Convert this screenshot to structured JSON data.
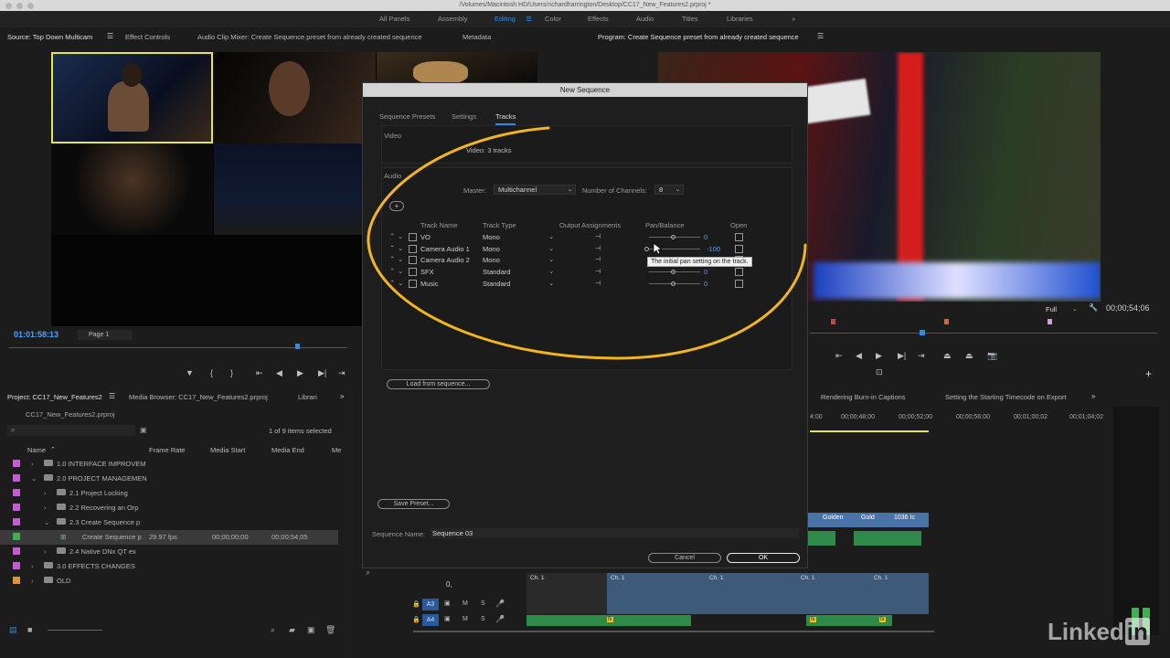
{
  "titlebar": {
    "path": "/Volumes/Macintosh HD/Users/richardharrington/Desktop/CC17_New_Features2.prproj *"
  },
  "workspaces": [
    "All Panels",
    "Assembly",
    "Editing",
    "Color",
    "Effects",
    "Audio",
    "Titles",
    "Libraries"
  ],
  "source_panel": {
    "tabs": [
      "Source: Top Down Multicam",
      "Effect Controls",
      "Audio Clip Mixer: Create Sequence preset from already created sequence",
      "Metadata"
    ],
    "timecode": "01:01:58:13",
    "page": "Page 1"
  },
  "program_panel": {
    "title": "Program: Create Sequence preset from already created sequence",
    "timecode": "00;00;54;06",
    "zoom": "Full"
  },
  "project_panel": {
    "tabs": [
      "Project: CC17_New_Features2",
      "Media Browser: CC17_New_Features2.prproj",
      "Librari"
    ],
    "file": "CC17_New_Features2.prproj",
    "selection": "1 of 9 items selected",
    "columns": [
      "Name",
      "Frame Rate",
      "Media Start",
      "Media End",
      "Me"
    ],
    "rows": [
      {
        "name": "1.0 INTERFACE IMPROVEM",
        "color": "#c85bd1",
        "indent": 0,
        "frame_rate": "",
        "start": "",
        "end": ""
      },
      {
        "name": "2.0 PROJECT MANAGEMEN",
        "color": "#c85bd1",
        "indent": 0,
        "frame_rate": "",
        "start": "",
        "end": ""
      },
      {
        "name": "2.1 Project Locking",
        "color": "#c85bd1",
        "indent": 1,
        "frame_rate": "",
        "start": "",
        "end": ""
      },
      {
        "name": "2.2 Recovering an Orp",
        "color": "#c85bd1",
        "indent": 1,
        "frame_rate": "",
        "start": "",
        "end": ""
      },
      {
        "name": "2.3 Create Sequence p",
        "color": "#c85bd1",
        "indent": 1,
        "frame_rate": "",
        "start": "",
        "end": ""
      },
      {
        "name": "Create Sequence p",
        "color": "#3fae54",
        "indent": 2,
        "frame_rate": "29.97 fps",
        "start": "00;00;00;00",
        "end": "00;00;54;05"
      },
      {
        "name": "2.4 Native DNx QT ex",
        "color": "#c85bd1",
        "indent": 1,
        "frame_rate": "",
        "start": "",
        "end": ""
      },
      {
        "name": "3.0 EFFECTS CHANGES",
        "color": "#c85bd1",
        "indent": 0,
        "frame_rate": "",
        "start": "",
        "end": ""
      },
      {
        "name": "OLD",
        "color": "#e0923a",
        "indent": 0,
        "frame_rate": "",
        "start": "",
        "end": ""
      }
    ]
  },
  "timeline": {
    "tabs": [
      "Rendering Burn-in Captions",
      "Setting the Starting Timecode on Export"
    ],
    "ruler": [
      "4:00",
      "00;00;48;00",
      "00;00;52;00",
      "00;00;56;00",
      "00;01;00;02",
      "00;01;04;02",
      "00;"
    ],
    "tracks": [
      "A3",
      "A4"
    ],
    "track_buttons": [
      "M",
      "S"
    ],
    "clip_labels": [
      "Golden",
      "Gold",
      "1036 Ic",
      "Ch. 1",
      "fx"
    ],
    "badge": "fx",
    "zero": "0,"
  },
  "dialog": {
    "title": "New Sequence",
    "tabs": [
      "Sequence Presets",
      "Settings",
      "Tracks"
    ],
    "video_label": "Video",
    "video_tracks": "Video:  3 tracks",
    "audio_label": "Audio",
    "master_label": "Master:",
    "master_value": "Multichannel",
    "channels_label": "Number of Channels:",
    "channels_value": "8",
    "add_button": "+",
    "columns": [
      "Track Name",
      "Track Type",
      "Output Assignments",
      "Pan/Balance",
      "Open"
    ],
    "tracks": [
      {
        "name": "VO",
        "type": "Mono",
        "pan": "0"
      },
      {
        "name": "Camera Audio 1",
        "type": "Mono",
        "pan": "-100"
      },
      {
        "name": "Camera Audio 2",
        "type": "Mono",
        "pan": ""
      },
      {
        "name": "SFX",
        "type": "Standard",
        "pan": "0"
      },
      {
        "name": "Music",
        "type": "Standard",
        "pan": "0"
      }
    ],
    "tooltip": "The initial pan setting on the track.",
    "load_button": "Load from sequence...",
    "save_preset": "Save Preset...",
    "sequence_name_label": "Sequence Name:",
    "sequence_name": "Sequence 03",
    "cancel": "Cancel",
    "ok": "OK"
  },
  "watermark": "Linked",
  "watermark_in": "in",
  "colors": {
    "accent": "#2d8ceb",
    "annotation": "#f2b51f",
    "selection": "#e6e64a"
  }
}
